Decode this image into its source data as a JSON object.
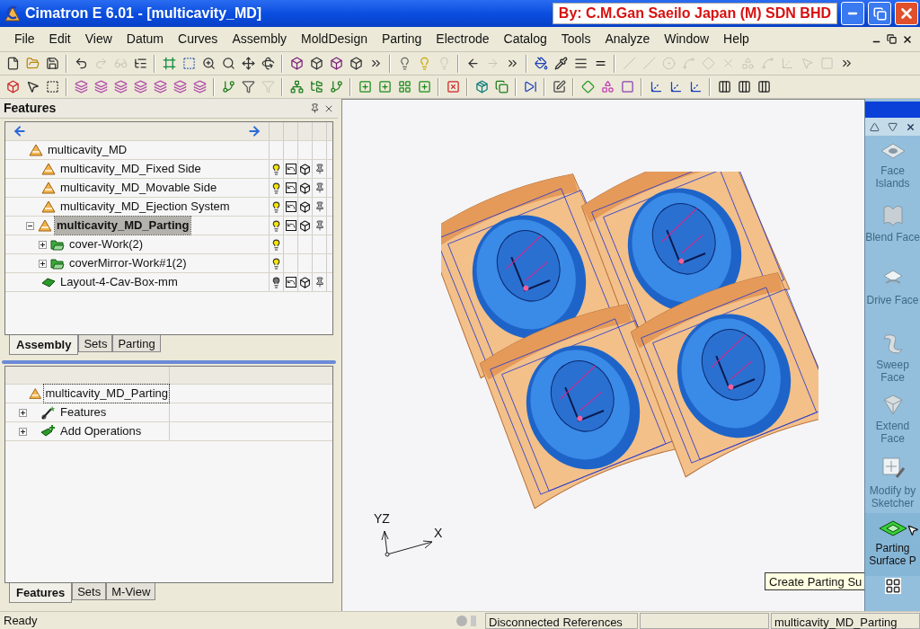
{
  "window": {
    "title": "Cimatron E 6.01 - [multicavity_MD]",
    "banner": "By: C.M.Gan Saeilo Japan (M) SDN BHD"
  },
  "menu": [
    "File",
    "Edit",
    "View",
    "Datum",
    "Curves",
    "Assembly",
    "MoldDesign",
    "Parting",
    "Electrode",
    "Catalog",
    "Tools",
    "Analyze",
    "Window",
    "Help"
  ],
  "toolbars": [
    [
      {
        "kind": "new",
        "disabled": false
      },
      {
        "kind": "open",
        "disabled": false
      },
      {
        "kind": "save",
        "disabled": false
      },
      {
        "kind": "sep"
      },
      {
        "kind": "undo",
        "disabled": false
      },
      {
        "kind": "redo",
        "disabled": true
      },
      {
        "kind": "glasses",
        "disabled": true
      },
      {
        "kind": "tree",
        "disabled": false
      },
      {
        "kind": "sep"
      },
      {
        "kind": "fit",
        "disabled": false
      },
      {
        "kind": "zoom-box",
        "disabled": false
      },
      {
        "kind": "zoom-in",
        "disabled": false
      },
      {
        "kind": "zoom",
        "disabled": false
      },
      {
        "kind": "pan",
        "disabled": false
      },
      {
        "kind": "rotate",
        "disabled": false
      },
      {
        "kind": "sep"
      },
      {
        "kind": "solid",
        "disabled": false
      },
      {
        "kind": "cube",
        "disabled": false
      },
      {
        "kind": "solid",
        "disabled": false
      },
      {
        "kind": "cube",
        "disabled": false
      },
      {
        "kind": "more",
        "disabled": false
      },
      {
        "kind": "sep"
      },
      {
        "kind": "bulb-off",
        "disabled": false
      },
      {
        "kind": "bulb",
        "disabled": false
      },
      {
        "kind": "bulb-off",
        "disabled": true
      },
      {
        "kind": "sep"
      },
      {
        "kind": "back",
        "disabled": false
      },
      {
        "kind": "forward",
        "disabled": true
      },
      {
        "kind": "more",
        "disabled": false
      },
      {
        "kind": "sep"
      },
      {
        "kind": "paint",
        "disabled": false
      },
      {
        "kind": "pick",
        "disabled": false
      },
      {
        "kind": "dashes",
        "disabled": false
      },
      {
        "kind": "lines",
        "disabled": false
      },
      {
        "kind": "sep"
      },
      {
        "kind": "line",
        "disabled": true
      },
      {
        "kind": "line",
        "disabled": true
      },
      {
        "kind": "point",
        "disabled": true
      },
      {
        "kind": "curve",
        "disabled": true
      },
      {
        "kind": "plane",
        "disabled": true
      },
      {
        "kind": "cross",
        "disabled": true
      },
      {
        "kind": "shapes",
        "disabled": true
      },
      {
        "kind": "curve",
        "disabled": true
      },
      {
        "kind": "axis",
        "disabled": true
      },
      {
        "kind": "pointer",
        "disabled": true
      },
      {
        "kind": "frame",
        "disabled": true
      },
      {
        "kind": "more",
        "disabled": false
      }
    ],
    [
      {
        "kind": "select-solid",
        "disabled": false
      },
      {
        "kind": "deselect",
        "disabled": false
      },
      {
        "kind": "select-box",
        "disabled": false
      },
      {
        "kind": "sep"
      },
      {
        "kind": "layers",
        "disabled": false
      },
      {
        "kind": "layers",
        "disabled": false
      },
      {
        "kind": "layers",
        "disabled": false
      },
      {
        "kind": "layers",
        "disabled": false
      },
      {
        "kind": "layers",
        "disabled": false
      },
      {
        "kind": "layers",
        "disabled": false
      },
      {
        "kind": "layers",
        "disabled": false
      },
      {
        "kind": "sep"
      },
      {
        "kind": "branch",
        "disabled": false
      },
      {
        "kind": "filter",
        "disabled": false
      },
      {
        "kind": "filter",
        "disabled": true
      },
      {
        "kind": "sep"
      },
      {
        "kind": "network",
        "disabled": false
      },
      {
        "kind": "folder-tree",
        "disabled": false
      },
      {
        "kind": "branch",
        "disabled": false
      },
      {
        "kind": "sep"
      },
      {
        "kind": "add",
        "disabled": false
      },
      {
        "kind": "add",
        "disabled": false
      },
      {
        "kind": "grid",
        "disabled": false
      },
      {
        "kind": "add",
        "disabled": false
      },
      {
        "kind": "sep"
      },
      {
        "kind": "remove",
        "disabled": false
      },
      {
        "kind": "sep"
      },
      {
        "kind": "package",
        "disabled": false
      },
      {
        "kind": "copy",
        "disabled": false
      },
      {
        "kind": "sep"
      },
      {
        "kind": "skip",
        "disabled": false
      },
      {
        "kind": "sep"
      },
      {
        "kind": "sketch",
        "disabled": false
      },
      {
        "kind": "sep"
      },
      {
        "kind": "plane",
        "disabled": false
      },
      {
        "kind": "shapes",
        "disabled": false
      },
      {
        "kind": "frame",
        "disabled": false
      },
      {
        "kind": "sep"
      },
      {
        "kind": "axis",
        "disabled": false
      },
      {
        "kind": "axis",
        "disabled": false
      },
      {
        "kind": "axis",
        "disabled": false
      },
      {
        "kind": "sep"
      },
      {
        "kind": "columns",
        "disabled": false
      },
      {
        "kind": "columns",
        "disabled": false
      },
      {
        "kind": "columns",
        "disabled": false
      }
    ]
  ],
  "features_panel": {
    "title": "Features",
    "tree": [
      {
        "label": "multicavity_MD",
        "kind": "assembly",
        "selected": false,
        "children": [
          {
            "label": "multicavity_MD_Fixed Side",
            "kind": "assembly",
            "selected": false,
            "lit": true,
            "extras": true
          },
          {
            "label": "multicavity_MD_Movable Side",
            "kind": "assembly",
            "selected": false,
            "lit": true,
            "extras": true
          },
          {
            "label": "multicavity_MD_Ejection System",
            "kind": "assembly",
            "selected": false,
            "lit": true,
            "extras": true
          },
          {
            "label": "multicavity_MD_Parting",
            "kind": "assembly",
            "selected": true,
            "expanded": true,
            "lit": true,
            "extras": true,
            "children": [
              {
                "label": "cover-Work(2)",
                "kind": "work",
                "selected": false,
                "expanded": false,
                "lit": true,
                "extras": false
              },
              {
                "label": "coverMirror-Work#1(2)",
                "kind": "work",
                "selected": false,
                "expanded": false,
                "lit": true,
                "extras": false
              }
            ]
          },
          {
            "label": "Layout-4-Cav-Box-mm",
            "kind": "layout",
            "selected": false,
            "lit": false,
            "extras": true
          }
        ]
      }
    ],
    "tabs": [
      {
        "label": "Assembly",
        "selected": true
      },
      {
        "label": "Sets",
        "selected": false
      },
      {
        "label": "Parting",
        "selected": false
      }
    ]
  },
  "operations_panel": {
    "tree": [
      {
        "label": "multicavity_MD_Parting",
        "kind": "assembly",
        "selected": true,
        "children": [
          {
            "label": "Features",
            "kind": "features",
            "selected": false,
            "expanded": false
          },
          {
            "label": "Add Operations",
            "kind": "add",
            "selected": false,
            "expanded": false
          }
        ]
      }
    ],
    "tabs": [
      {
        "label": "Features",
        "selected": true
      },
      {
        "label": "Sets",
        "selected": false
      },
      {
        "label": "M-View",
        "selected": false
      }
    ]
  },
  "viewport": {
    "axis_labels": [
      "YZ",
      "X"
    ],
    "tooltip": "Create Parting Su"
  },
  "tool_palette": {
    "items": [
      {
        "label": "Face Islands",
        "kind": "islands",
        "disabled": true
      },
      {
        "label": "Blend Face",
        "kind": "blend",
        "disabled": true
      },
      {
        "label": "Drive Face",
        "kind": "drive",
        "disabled": true
      },
      {
        "label": "Sweep Face",
        "kind": "sweep",
        "disabled": true
      },
      {
        "label": "Extend Face",
        "kind": "extend",
        "disabled": true
      },
      {
        "label": "Modify by Sketcher",
        "kind": "modify",
        "disabled": true
      },
      {
        "label": "Parting Surface P",
        "kind": "parting",
        "disabled": false
      }
    ]
  },
  "status_bar": {
    "message": "Ready",
    "references": "Disconnected References",
    "active_part": "multicavity_MD_Parting"
  }
}
